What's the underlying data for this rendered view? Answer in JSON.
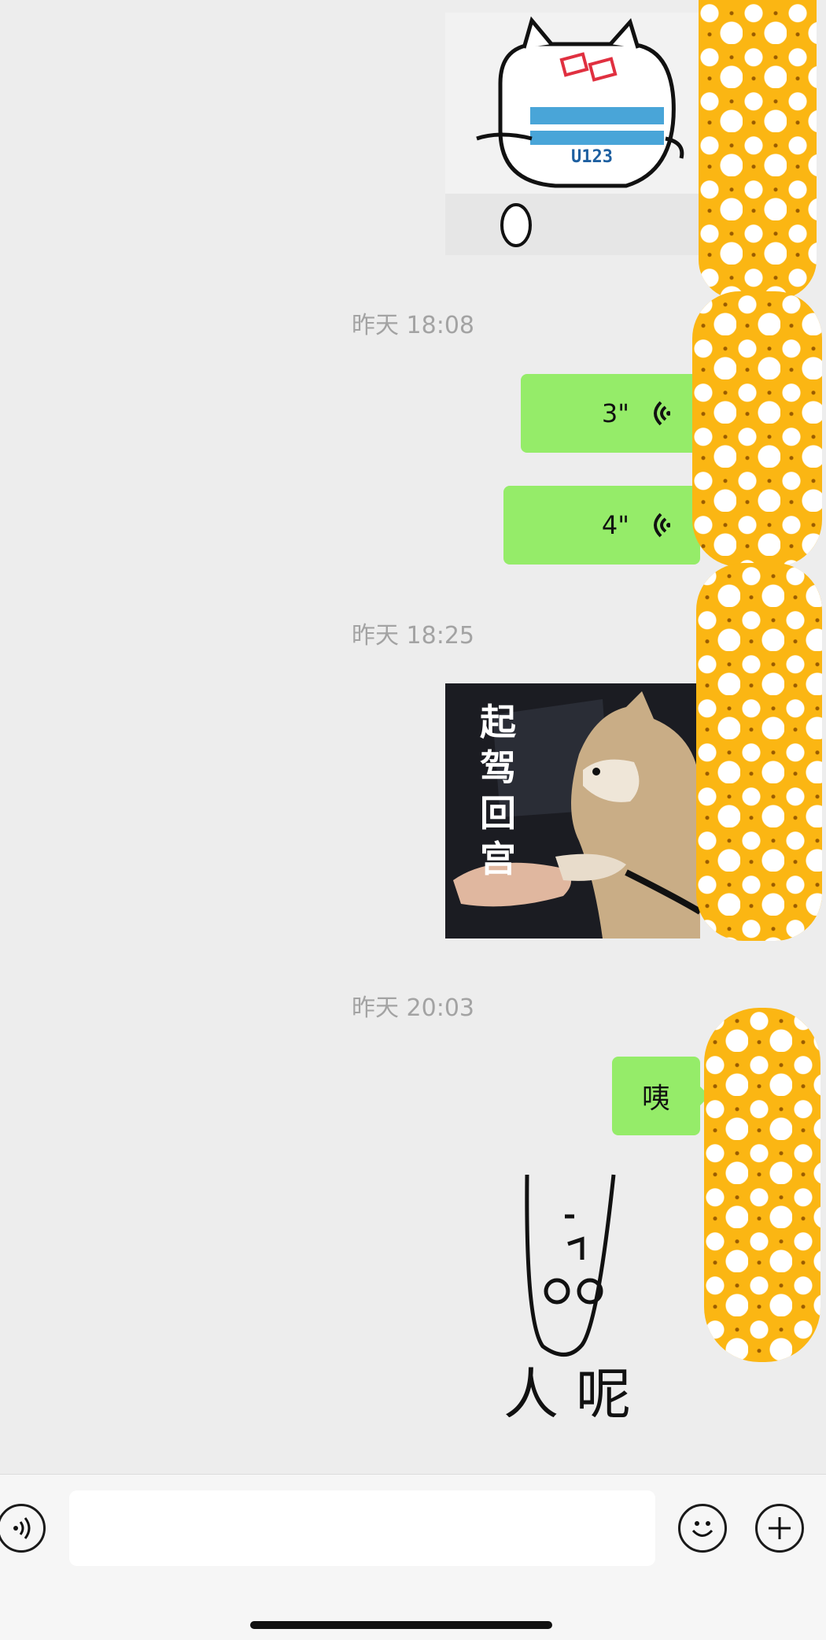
{
  "timestamps": [
    "昨天 18:08",
    "昨天 18:25",
    "昨天 20:03"
  ],
  "voice_messages": [
    {
      "duration": "3\""
    },
    {
      "duration": "4\""
    }
  ],
  "stickers": {
    "cat_label": "U123",
    "dog_caption": [
      "起",
      "驾",
      "回",
      "宫"
    ],
    "face_caption": "人 呢"
  },
  "text_message": "咦",
  "input_bar": {
    "placeholder": "",
    "voice_icon": "voice-icon",
    "emoji_icon": "emoji-icon",
    "plus_icon": "plus-icon"
  },
  "colors": {
    "bubble": "#95ec69",
    "background": "#ededed",
    "redaction": "#fbb613"
  }
}
